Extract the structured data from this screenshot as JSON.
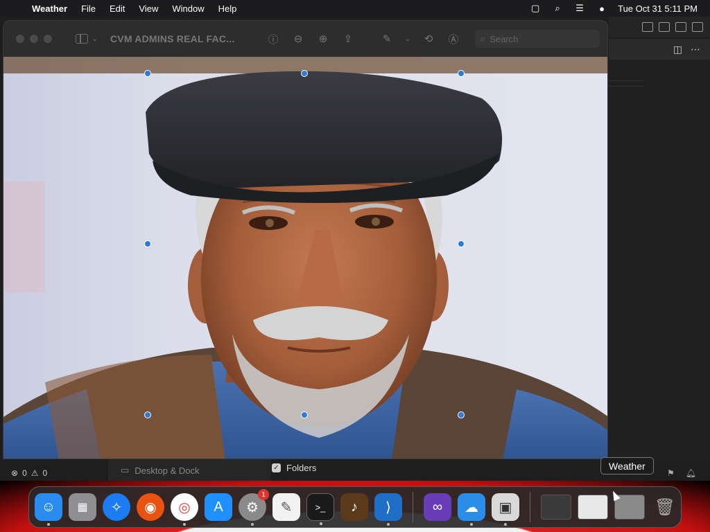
{
  "menubar": {
    "app_name": "Weather",
    "items": [
      "File",
      "Edit",
      "View",
      "Window",
      "Help"
    ],
    "datetime": "Tue Oct 31  5:11 PM"
  },
  "preview": {
    "title": "CVM ADMINS REAL FAC...",
    "search_placeholder": "Search"
  },
  "status": {
    "errors": "0",
    "warnings": "0",
    "desktop_dock_label": "Desktop & Dock",
    "folders_label": "Folders"
  },
  "tooltip": {
    "text": "Weather"
  },
  "dock": {
    "apps": [
      {
        "name": "Finder",
        "icon": "finder-icon",
        "color": "#2b8cf0"
      },
      {
        "name": "Launchpad",
        "icon": "launchpad-icon",
        "color": "#8e8e93"
      },
      {
        "name": "Safari",
        "icon": "safari-icon",
        "color": "#1a7cf0"
      },
      {
        "name": "Firefox",
        "icon": "firefox-icon",
        "color": "#e8540f"
      },
      {
        "name": "Chrome",
        "icon": "chrome-icon",
        "color": "#ffffff"
      },
      {
        "name": "App Store",
        "icon": "app-store-icon",
        "color": "#1e90ff"
      },
      {
        "name": "System Settings",
        "icon": "system-settings-icon",
        "color": "#8a8a8a",
        "badge": "1"
      },
      {
        "name": "TextEdit",
        "icon": "textedit-icon",
        "color": "#f2f2f2"
      },
      {
        "name": "Terminal",
        "icon": "terminal-icon",
        "color": "#1a1a1a"
      },
      {
        "name": "GarageBand",
        "icon": "garageband-icon",
        "color": "#5a3a1a"
      },
      {
        "name": "VS Code",
        "icon": "vscode-icon",
        "color": "#1f6fc7"
      }
    ],
    "apps2": [
      {
        "name": "Visual Studio",
        "icon": "visual-studio-icon",
        "color": "#6a3db8"
      },
      {
        "name": "Weather",
        "icon": "weather-icon",
        "color": "#2a8ee8"
      },
      {
        "name": "Preview",
        "icon": "preview-icon",
        "color": "#d9d9d9"
      }
    ]
  }
}
